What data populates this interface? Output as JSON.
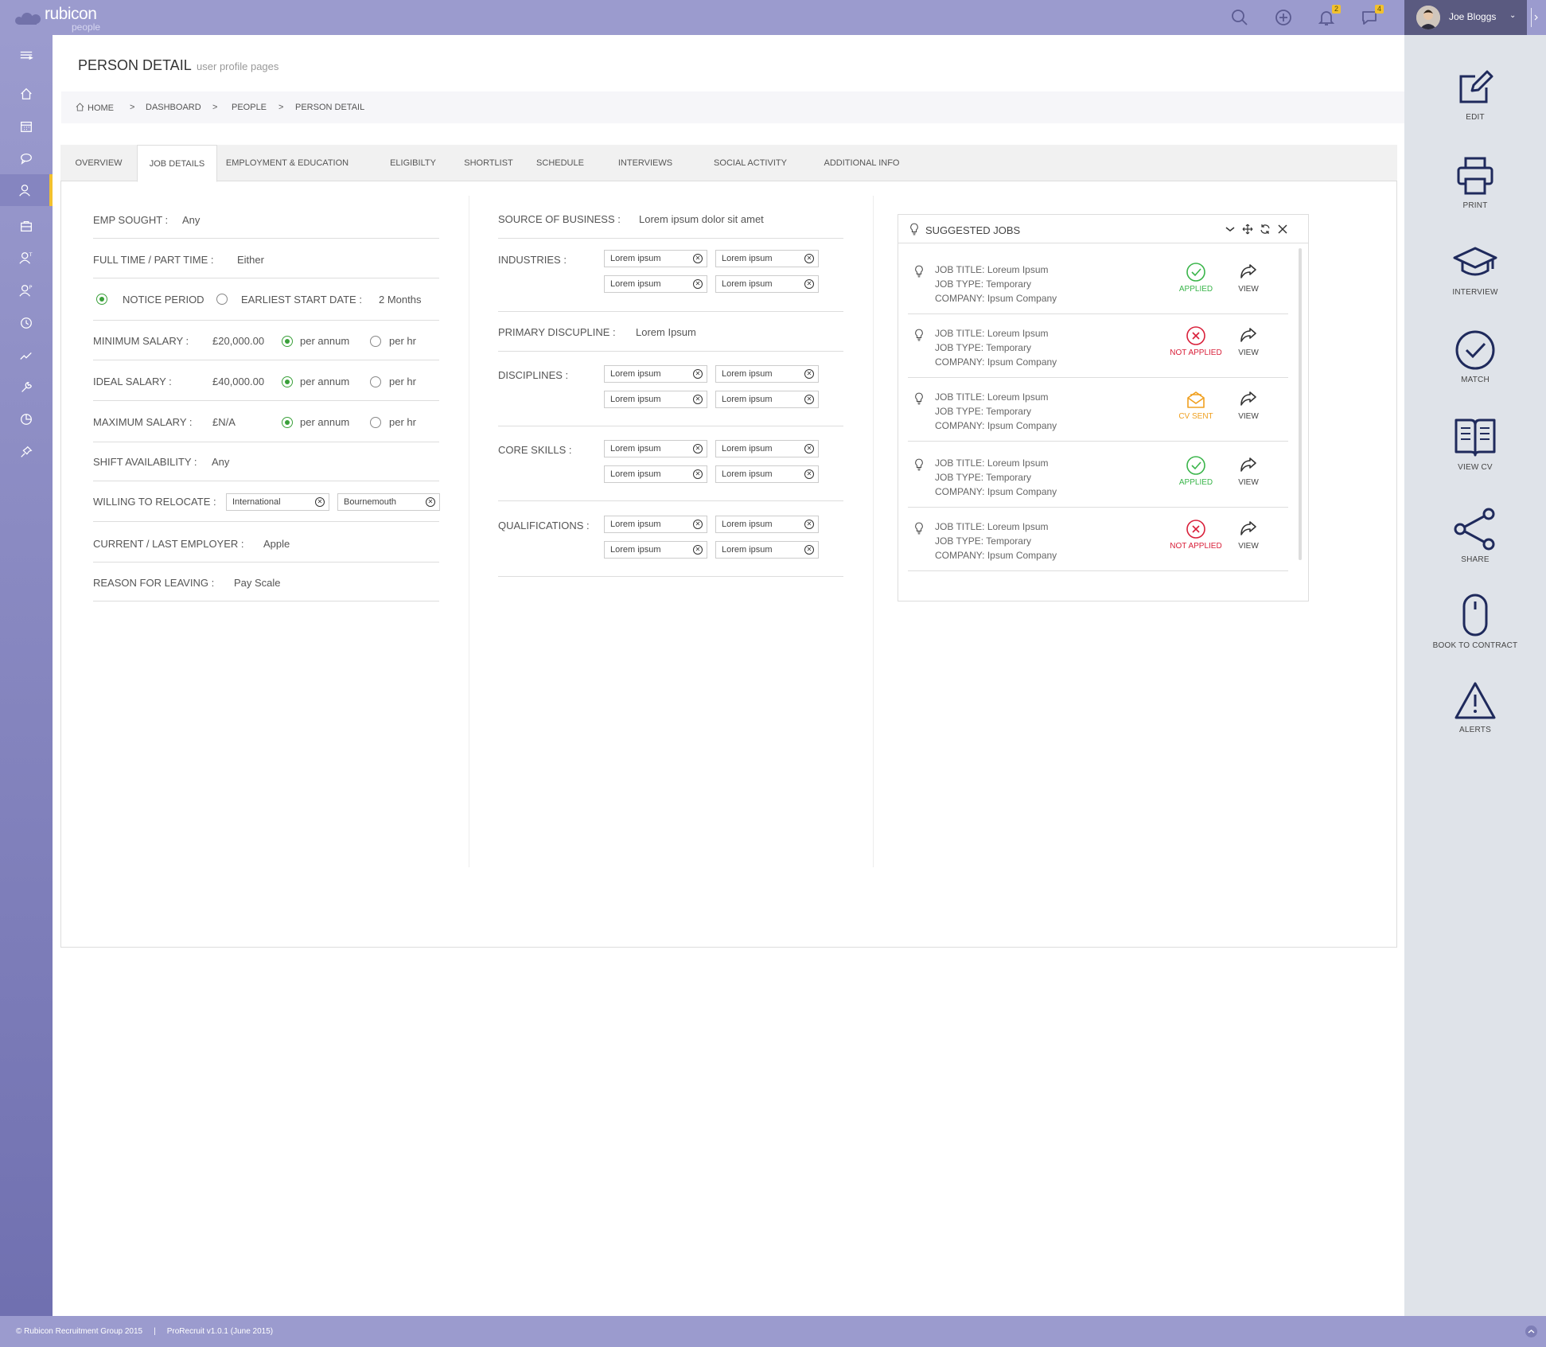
{
  "app": {
    "logo_name": "rubicon",
    "logo_sub": "people",
    "user_name": "Joe Bloggs",
    "notif_count": "2",
    "msg_count": "4"
  },
  "page": {
    "title": "PERSON DETAIL",
    "subtitle": "user profile pages"
  },
  "breadcrumb": [
    "HOME",
    "DASHBOARD",
    "PEOPLE",
    "PERSON DETAIL"
  ],
  "breadcrumb_sep": ">",
  "tabs": [
    "OVERVIEW",
    "JOB DETAILS",
    "EMPLOYMENT & EDUCATION",
    "ELIGIBILTY",
    "SHORTLIST",
    "SCHEDULE",
    "INTERVIEWS",
    "SOCIAL ACTIVITY",
    "ADDITIONAL INFO"
  ],
  "active_tab": "JOB DETAILS",
  "left": {
    "emp_sought": {
      "label": "EMP SOUGHT :",
      "value": "Any"
    },
    "ftpt": {
      "label": "FULL TIME / PART TIME :",
      "value": "Either"
    },
    "notice": {
      "notice_label": "NOTICE PERIOD",
      "earliest_label": "EARLIEST START DATE :",
      "value": "2 Months",
      "selected": "notice"
    },
    "min_salary": {
      "label": "MINIMUM SALARY :",
      "value": "£20,000.00",
      "opt1": "per annum",
      "opt2": "per hr"
    },
    "ideal_salary": {
      "label": "IDEAL SALARY :",
      "value": "£40,000.00",
      "opt1": "per annum",
      "opt2": "per hr"
    },
    "max_salary": {
      "label": "MAXIMUM SALARY :",
      "value": "£N/A",
      "opt1": "per annum",
      "opt2": "per hr"
    },
    "shift": {
      "label": "SHIFT  AVAILABILITY  :",
      "value": "Any"
    },
    "relocate": {
      "label": "WILLING TO RELOCATE  :",
      "tag1": "International",
      "tag2": "Bournemouth"
    },
    "employer": {
      "label": "CURRENT / LAST EMPLOYER :",
      "value": "Apple"
    },
    "reason": {
      "label": "REASON FOR LEAVING :",
      "value": "Pay Scale"
    }
  },
  "middle": {
    "source": {
      "label": "SOURCE OF BUSINESS :",
      "value": "Lorem ipsum dolor sit amet"
    },
    "industries": {
      "label": "INDUSTRIES :",
      "tags": [
        "Lorem ipsum",
        "Lorem ipsum",
        "Lorem ipsum",
        "Lorem ipsum"
      ]
    },
    "primary": {
      "label": "PRIMARY DISCUPLINE :",
      "value": "Lorem Ipsum"
    },
    "disciplines": {
      "label": "DISCIPLINES :",
      "tags": [
        "Lorem ipsum",
        "Lorem ipsum",
        "Lorem ipsum",
        "Lorem ipsum"
      ]
    },
    "core": {
      "label": "CORE SKILLS :",
      "tags": [
        "Lorem ipsum",
        "Lorem ipsum",
        "Lorem ipsum",
        "Lorem ipsum"
      ]
    },
    "quals": {
      "label": "QUALIFICATIONS :",
      "tags": [
        "Lorem ipsum",
        "Lorem ipsum",
        "Lorem ipsum",
        "Lorem ipsum"
      ]
    }
  },
  "suggested": {
    "title": "SUGGESTED JOBS",
    "job_title_label": "JOB TITLE:",
    "job_type_label": "JOB TYPE:",
    "company_label": "COMPANY:",
    "view_label": "VIEW",
    "jobs": [
      {
        "title": "Loreum Ipsum",
        "type": "Temporary",
        "company": "Ipsum Company",
        "status": "APPLIED",
        "status_color": "#3ab54a",
        "status_icon": "check-circle-icon"
      },
      {
        "title": "Loreum Ipsum",
        "type": "Temporary",
        "company": "Ipsum Company",
        "status": "NOT APPLIED",
        "status_color": "#d9203a",
        "status_icon": "x-circle-icon"
      },
      {
        "title": "Loreum Ipsum",
        "type": "Temporary",
        "company": "Ipsum Company",
        "status": "CV SENT",
        "status_color": "#f0a020",
        "status_icon": "envelope-open-icon"
      },
      {
        "title": "Loreum Ipsum",
        "type": "Temporary",
        "company": "Ipsum Company",
        "status": "APPLIED",
        "status_color": "#3ab54a",
        "status_icon": "check-circle-icon"
      },
      {
        "title": "Loreum Ipsum",
        "type": "Temporary",
        "company": "Ipsum Company",
        "status": "NOT APPLIED",
        "status_color": "#d9203a",
        "status_icon": "x-circle-icon"
      }
    ]
  },
  "actions": [
    "EDIT",
    "PRINT",
    "INTERVIEW",
    "MATCH",
    "VIEW CV",
    "SHARE",
    "BOOK TO CONTRACT",
    "ALERTS"
  ],
  "footer": {
    "copyright": "© Rubicon Recruitment Group 2015",
    "sep": "|",
    "version": "ProRecruit v1.0.1 (June 2015)"
  },
  "colors": {
    "header": "#9b9bce",
    "accent": "#f2c12e",
    "icon_navy": "#1f2a5c",
    "applied": "#3ab54a",
    "not_applied": "#d9203a",
    "cv_sent": "#f0a020"
  }
}
